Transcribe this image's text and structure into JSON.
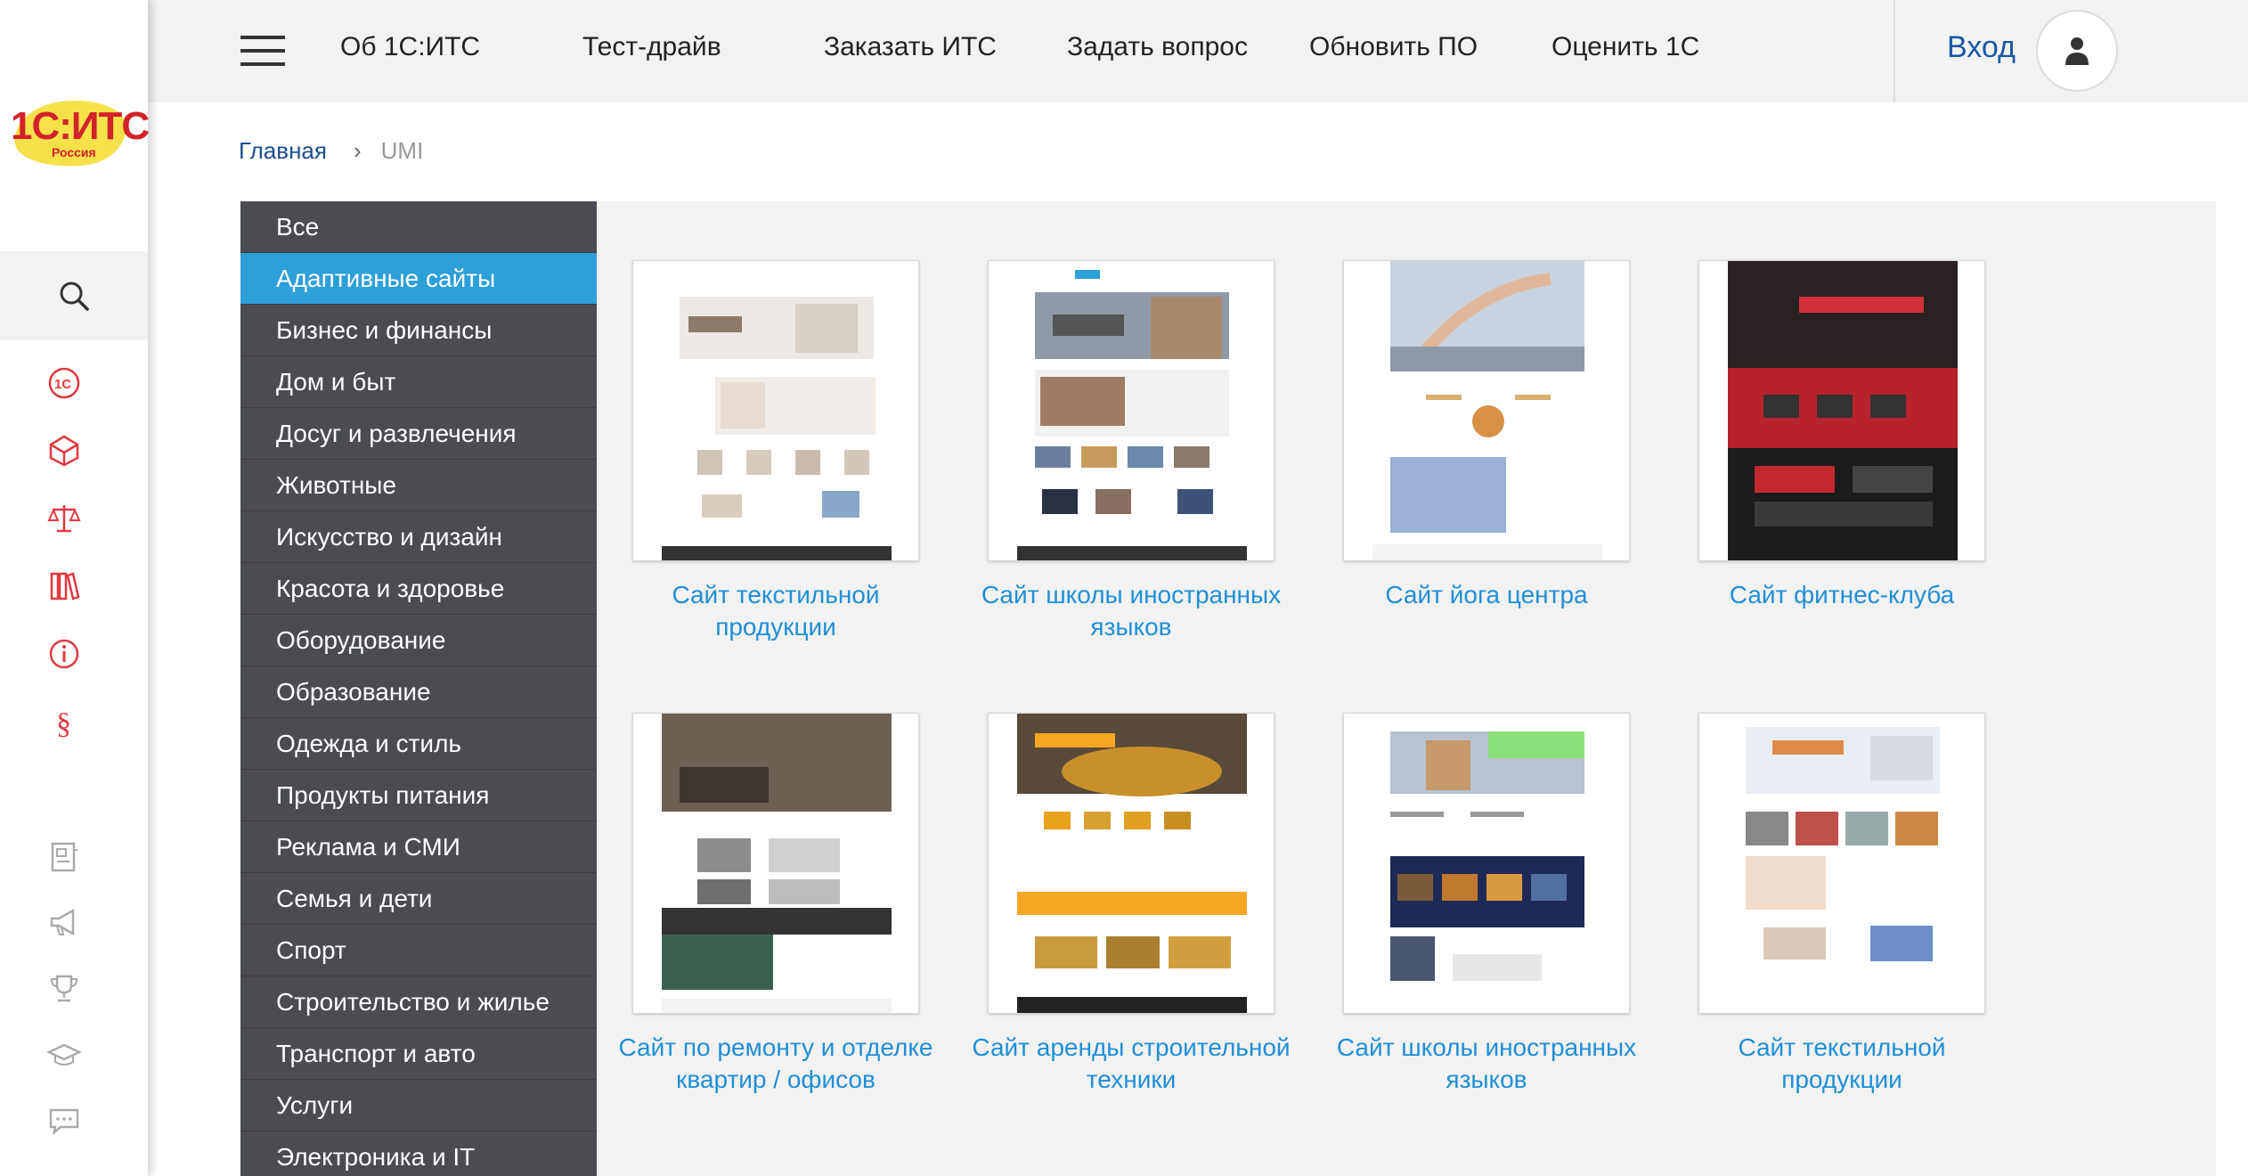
{
  "logo": {
    "main": "1С:ИТС",
    "sub": "Россия"
  },
  "topnav": {
    "items": [
      "Об 1С:ИТС",
      "Тест-драйв",
      "Заказать ИТС",
      "Задать вопрос",
      "Обновить ПО",
      "Оценить 1С"
    ],
    "login": "Вход"
  },
  "breadcrumb": {
    "home": "Главная",
    "current": "UMI"
  },
  "rail_icons": [
    "search-icon",
    "1c-icon",
    "cube-icon",
    "scales-icon",
    "books-icon",
    "info-icon",
    "paragraph-icon",
    "document-icon",
    "megaphone-icon",
    "trophy-icon",
    "graduation-cap-icon",
    "chat-icon"
  ],
  "categories": [
    "Все",
    "Адаптивные сайты",
    "Бизнес и финансы",
    "Дом и быт",
    "Досуг и развлечения",
    "Животные",
    "Искусство и дизайн",
    "Красота и здоровье",
    "Оборудование",
    "Образование",
    "Одежда и стиль",
    "Продукты питания",
    "Реклама и СМИ",
    "Семья и дети",
    "Спорт",
    "Строительство и жилье",
    "Транспорт и авто",
    "Услуги",
    "Электроника и IT"
  ],
  "active_category": "Адаптивные сайты",
  "templates": [
    {
      "title": "Сайт текстильной продукции"
    },
    {
      "title": "Сайт школы иностранных языков"
    },
    {
      "title": "Сайт йога центра"
    },
    {
      "title": "Сайт фитнес-клуба"
    },
    {
      "title": "Сайт по ремонту и отделке квартир / офисов"
    },
    {
      "title": "Сайт аренды строительной техники"
    },
    {
      "title": "Сайт школы иностранных языков"
    },
    {
      "title": "Сайт текстильной продукции"
    }
  ],
  "colors": {
    "accent": "#2d9fd9",
    "link": "#1f8fd6",
    "sidebar": "#4a4c52",
    "brand_red": "#d2232a",
    "login": "#1a58a6"
  }
}
